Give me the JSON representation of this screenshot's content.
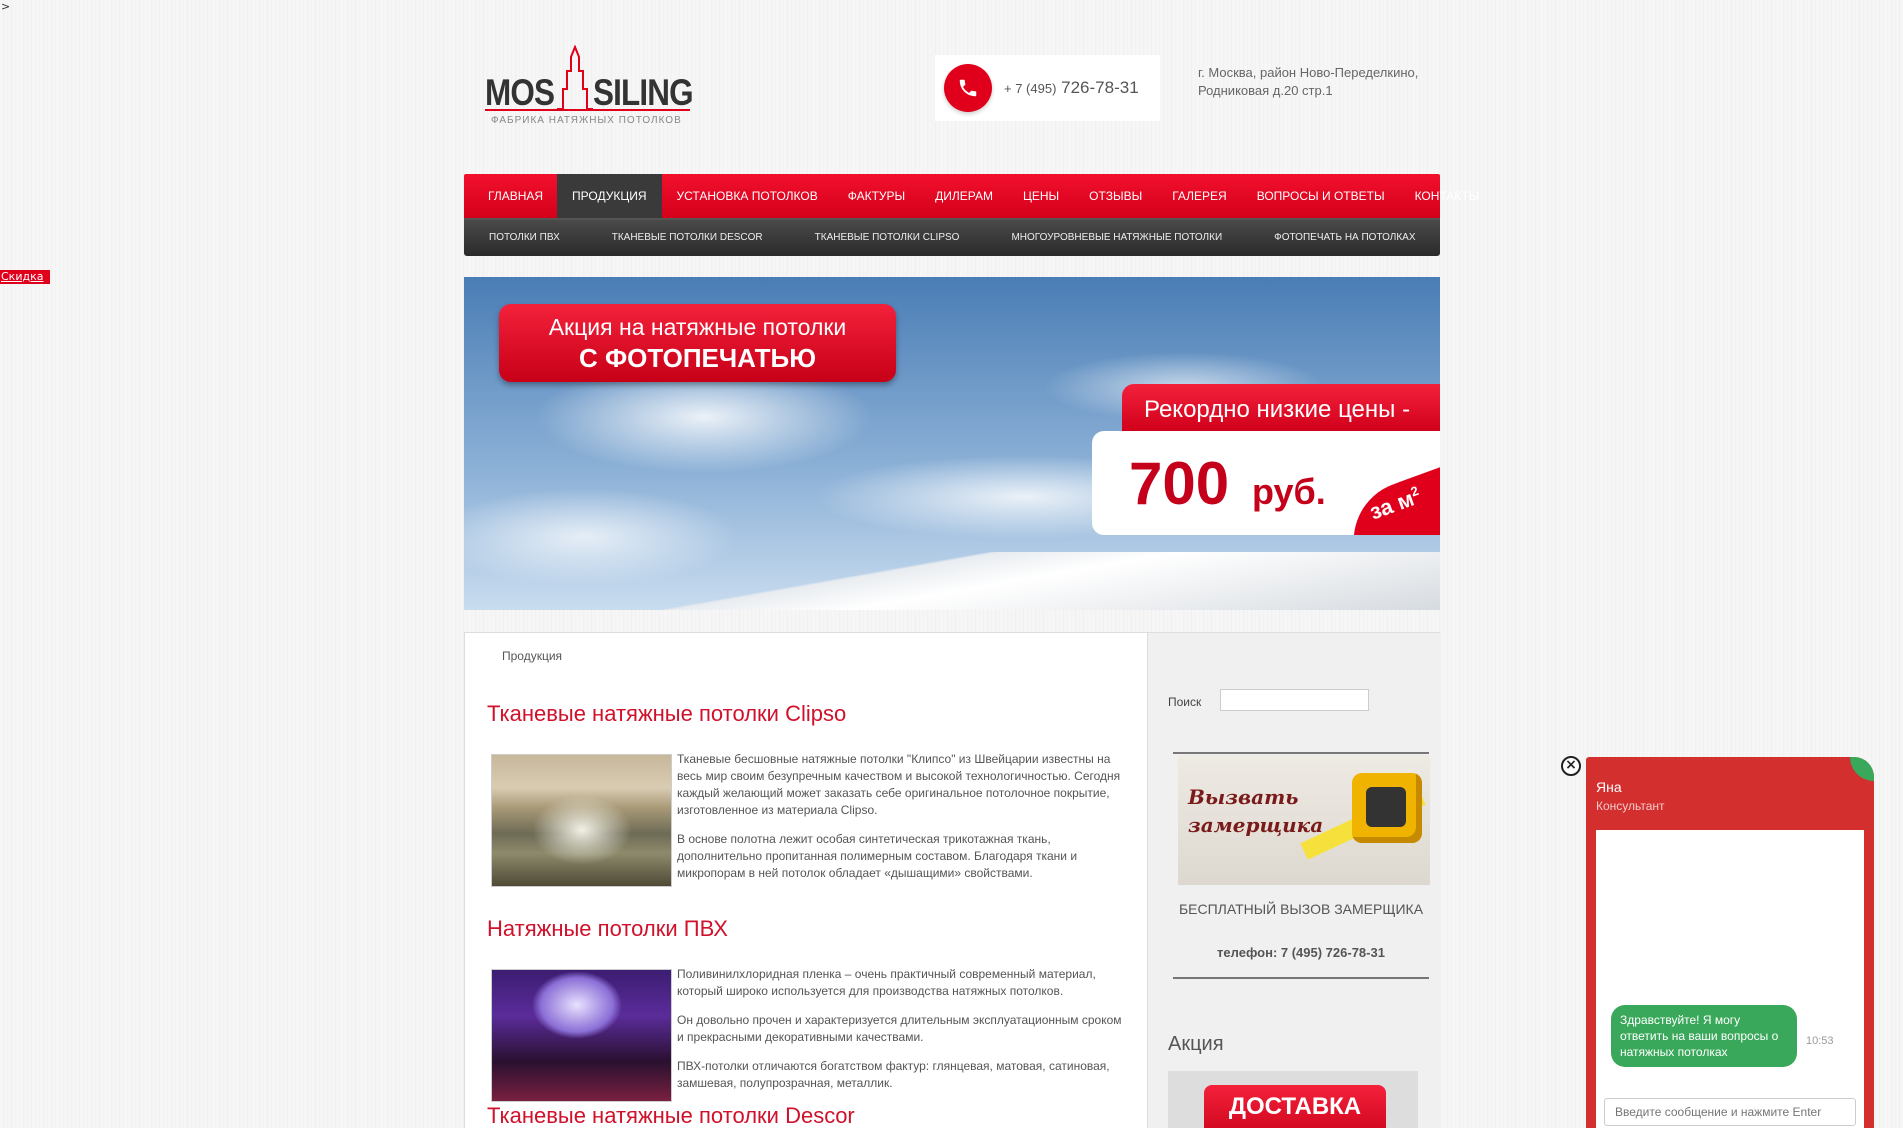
{
  "corner_char": ">",
  "discount_tab": "Скидка",
  "logo": {
    "left": "MOS",
    "right": "SILING",
    "subtitle": "ФАБРИКА НАТЯЖНЫХ ПОТОЛКОВ"
  },
  "header": {
    "phone_prefix": "+ 7 (495)",
    "phone_number": "726-78-31",
    "address_line1": "г. Москва, район Ново-Переделкино,",
    "address_line2": "Родниковая д.20 стр.1"
  },
  "nav": [
    {
      "label": "Главная"
    },
    {
      "label": "Продукция"
    },
    {
      "label": "Установка потолков"
    },
    {
      "label": "Фактуры"
    },
    {
      "label": "Дилерам"
    },
    {
      "label": "Цены"
    },
    {
      "label": "Отзывы"
    },
    {
      "label": "Галерея"
    },
    {
      "label": "Вопросы и ответы"
    },
    {
      "label": "Контакты"
    }
  ],
  "subnav": [
    {
      "label": "Потолки ПВХ"
    },
    {
      "label": "Тканевые потолки Descor"
    },
    {
      "label": "Тканевые потолки Clipso"
    },
    {
      "label": "Многоуровневые натяжные потолки"
    },
    {
      "label": "Фотопечать на потолках"
    }
  ],
  "banner": {
    "promo_line1": "Акция на натяжные потолки",
    "promo_line2": "С ФОТОПЕЧАТЬЮ",
    "record": "Рекордно низкие цены -",
    "price": "700",
    "currency": "руб.",
    "unit": "за м",
    "unit_sup": "2"
  },
  "breadcrumb": "Продукция",
  "articles": [
    {
      "title": "Тканевые натяжные потолки Clipso",
      "paragraphs": [
        "Тканевые бесшовные натяжные потолки \"Клипсо\" из Швейцарии известны на весь мир своим безупречным качеством и высокой технологичностью. Сегодня каждый желающий может заказать себе оригинальное потолочное покрытие, изготовленное из материала Clipso.",
        "В основе полотна лежит особая синтетическая трикотажная ткань, дополнительно пропитанная полимерным составом. Благодаря ткани и микропорам в ней потолок обладает «дышащими» свойствами."
      ]
    },
    {
      "title": "Натяжные потолки ПВХ",
      "paragraphs": [
        "Поливинилхлоридная пленка – очень практичный современный материал, который широко используется для производства натяжных потолков.",
        "Он довольно прочен и характеризуется длительным эксплуатационным сроком и прекрасными декоративными качествами.",
        "ПВХ-потолки отличаются богатством фактур: глянцевая, матовая, сатиновая, замшевая, полупрозрачная, металлик."
      ]
    },
    {
      "title": "Тканевые натяжные потолки Descor"
    }
  ],
  "sidebar": {
    "search_label": "Поиск",
    "measure_line1": "Вызвать",
    "measure_line2": "замерщика",
    "measure_caption": "Бесплатный вызов замерщика",
    "measure_phone": "телефон: 7 (495) 726-78-31",
    "promo_heading": "Акция",
    "promo_thumb": "ДОСТАВКА"
  },
  "chat": {
    "close": "×",
    "name": "Яна",
    "role": "Консультант",
    "message": "Здравствуйте! Я могу ответить на ваши вопросы о натяжных потолках",
    "time": "10:53",
    "input_placeholder": "Введите сообщение и нажмите Enter"
  }
}
